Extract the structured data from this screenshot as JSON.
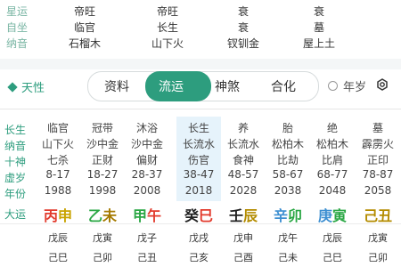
{
  "top": {
    "rows": [
      {
        "label": "星运",
        "values": [
          "帝旺",
          "帝旺",
          "衰",
          "衰"
        ]
      },
      {
        "label": "自坐",
        "values": [
          "临官",
          "长生",
          "衰",
          "墓"
        ]
      },
      {
        "label": "纳音",
        "values": [
          "石榴木",
          "山下火",
          "钗钏金",
          "屋上土"
        ]
      }
    ]
  },
  "tabs": {
    "brand": "天性",
    "items": [
      "资料",
      "流运",
      "神煞",
      "合化"
    ],
    "active_index": 1,
    "toggle_label": "年岁",
    "toggle_checked": false
  },
  "side_labels": [
    "长生",
    "纳音",
    "十神",
    "虚岁",
    "年份",
    "大运"
  ],
  "columns": [
    {
      "l1": "临官",
      "l2": "山下火",
      "l3": "七杀",
      "l4": "8-17",
      "l5": "1988",
      "g": "丙",
      "z": "申",
      "gc": "#e23b2d",
      "zc": "#c9a300",
      "ly1": "戊辰",
      "ly2": "己巳",
      "highlight": false
    },
    {
      "l1": "冠带",
      "l2": "沙中金",
      "l3": "正财",
      "l4": "18-27",
      "l5": "1998",
      "g": "乙",
      "z": "未",
      "gc": "#2aa744",
      "zc": "#a57a00",
      "ly1": "戊寅",
      "ly2": "己卯",
      "highlight": false
    },
    {
      "l1": "沐浴",
      "l2": "沙中金",
      "l3": "偏财",
      "l4": "28-37",
      "l5": "2008",
      "g": "甲",
      "z": "午",
      "gc": "#2aa744",
      "zc": "#e23b2d",
      "ly1": "戊子",
      "ly2": "己丑",
      "highlight": false
    },
    {
      "l1": "长生",
      "l2": "长流水",
      "l3": "伤官",
      "l4": "38-47",
      "l5": "2018",
      "g": "癸",
      "z": "巳",
      "gc": "#222222",
      "zc": "#e23b2d",
      "ly1": "戊戌",
      "ly2": "己亥",
      "highlight": true
    },
    {
      "l1": "养",
      "l2": "长流水",
      "l3": "食神",
      "l4": "48-57",
      "l5": "2028",
      "g": "壬",
      "z": "辰",
      "gc": "#222222",
      "zc": "#b48c00",
      "ly1": "戊申",
      "ly2": "己酉",
      "highlight": false
    },
    {
      "l1": "胎",
      "l2": "松柏木",
      "l3": "比劫",
      "l4": "58-67",
      "l5": "2038",
      "g": "辛",
      "z": "卯",
      "gc": "#3d8fd1",
      "zc": "#2aa744",
      "ly1": "戊午",
      "ly2": "己未",
      "highlight": false
    },
    {
      "l1": "绝",
      "l2": "松柏木",
      "l3": "比肩",
      "l4": "68-77",
      "l5": "2048",
      "g": "庚",
      "z": "寅",
      "gc": "#3d8fd1",
      "zc": "#2aa744",
      "ly1": "戊辰",
      "ly2": "己巳",
      "highlight": false
    },
    {
      "l1": "墓",
      "l2": "霹雳火",
      "l3": "正印",
      "l4": "78-87",
      "l5": "2058",
      "g": "己",
      "z": "丑",
      "gc": "#b48c00",
      "zc": "#b48c00",
      "ly1": "戊寅",
      "ly2": "己卯",
      "highlight": false
    }
  ]
}
